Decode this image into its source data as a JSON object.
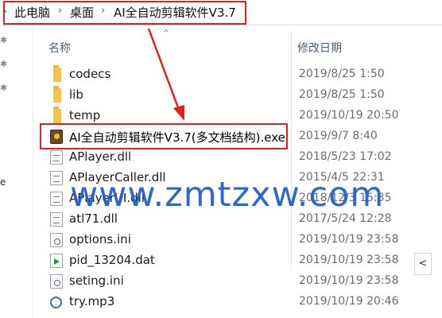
{
  "address_bar": {
    "root_chevron": "›",
    "crumbs": [
      "此电脑",
      "桌面",
      "AI全自动剪辑软件V3.7"
    ],
    "separator": "›"
  },
  "header": {
    "name_label": "名称",
    "date_label": "修改日期",
    "sort_indicator": "^"
  },
  "files": [
    {
      "name": "codecs",
      "date": "2019/8/25 1:50",
      "icon": "folder-icon"
    },
    {
      "name": "lib",
      "date": "2019/8/25 1:50",
      "icon": "folder-icon"
    },
    {
      "name": "temp",
      "date": "2019/10/19 20:50",
      "icon": "folder-icon"
    },
    {
      "name": "AI全自动剪辑软件V3.7(多文档结构).exe",
      "date": "2019/9/7 8:40",
      "icon": "exe-icon"
    },
    {
      "name": "APlayer.dll",
      "date": "2018/5/23 17:02",
      "icon": "dll-file-icon"
    },
    {
      "name": "APlayerCaller.dll",
      "date": "2015/4/5 22:31",
      "icon": "dll-file-icon"
    },
    {
      "name": "APlayerUI.dll",
      "date": "2018/12/3 15:35",
      "icon": "dll-file-icon"
    },
    {
      "name": "atl71.dll",
      "date": "2017/5/24 12:28",
      "icon": "dll-file-icon"
    },
    {
      "name": "options.ini",
      "date": "2019/10/19 23:58",
      "icon": "ini-file-icon"
    },
    {
      "name": "pid_13204.dat",
      "date": "2019/10/19 23:58",
      "icon": "dat-file-icon"
    },
    {
      "name": "seting.ini",
      "date": "2019/10/19 23:58",
      "icon": "ini-file-icon"
    },
    {
      "name": "try.mp3",
      "date": "2019/10/19 20:46",
      "icon": "mp3-file-icon"
    }
  ],
  "watermark": "www.zmtzxw.com",
  "scroll": {
    "collapse_glyph": "<"
  },
  "nav": {
    "pin_glyph": "✱",
    "mark": "e"
  },
  "colors": {
    "highlight": "#e0201b",
    "watermark": "#1f5fd0",
    "folder": "#f3c44a"
  }
}
